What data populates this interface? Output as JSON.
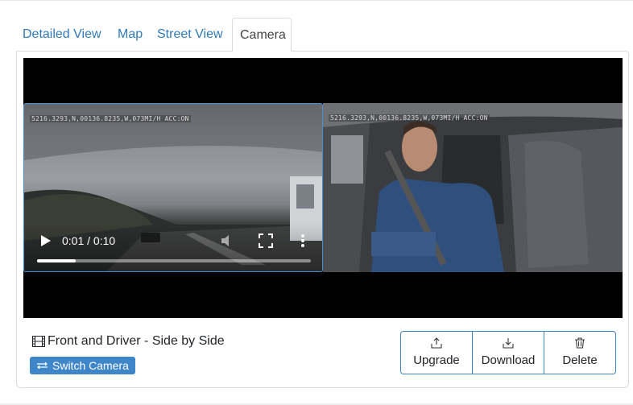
{
  "tabs": [
    {
      "label": "Detailed View",
      "active": false
    },
    {
      "label": "Map",
      "active": false
    },
    {
      "label": "Street View",
      "active": false
    },
    {
      "label": "Camera",
      "active": true
    }
  ],
  "video": {
    "front_overlay": "5216.3293,N,00136.8235,W,073MI/H ACC:ON",
    "driver_overlay": "5216.3293,N,00136.8235,W,073MI/H ACC:ON",
    "current_time": "0:01",
    "duration": "0:10",
    "time_display": "0:01 / 0:10",
    "progress_fraction": 0.14
  },
  "caption": {
    "icon": "film-icon",
    "text": "Front and Driver - Side by Side"
  },
  "switch_camera": {
    "icon": "swap-arrows-icon",
    "label": "Switch Camera"
  },
  "actions": [
    {
      "icon": "upload-icon",
      "label": "Upgrade"
    },
    {
      "icon": "download-icon",
      "label": "Download"
    },
    {
      "icon": "trash-icon",
      "label": "Delete"
    }
  ],
  "colors": {
    "link": "#2f7ab9",
    "accent": "#3f86c8",
    "player_bg": "#000000"
  }
}
